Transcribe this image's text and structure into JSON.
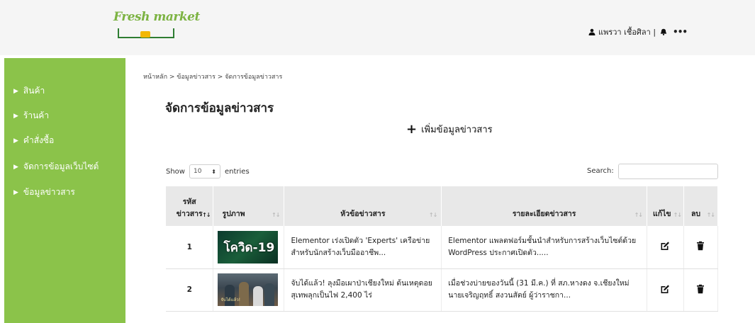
{
  "header": {
    "logo_text": "Fresh market",
    "user_name": "แพรวา เชื้อศิลา |",
    "more_label": "•••"
  },
  "sidebar": {
    "items": [
      {
        "label": "สินค้า"
      },
      {
        "label": "ร้านค้า"
      },
      {
        "label": "คำสั่งซื้อ"
      },
      {
        "label": "จัดการข้อมูลเว็บไซต์"
      },
      {
        "label": "ข้อมูลข่าวสาร"
      }
    ]
  },
  "breadcrumb": "หน้าหลัก > ข้อมูลข่าวสาร > จัดการข้อมูลข่าวสาร",
  "page_title": "จัดการข้อมูลข่าวสาร",
  "add_button": {
    "plus": "+",
    "label": "เพิ่มข้อมูลข่าวสาร"
  },
  "table_controls": {
    "show_label": "Show",
    "page_size": "10",
    "entries_label": "entries",
    "search_label": "Search:",
    "search_value": ""
  },
  "table": {
    "columns": [
      {
        "line1": "รหัส",
        "line2": "ข่าวสาร",
        "sort": "↑↓"
      },
      {
        "line1": "",
        "line2": "รูปภาพ",
        "sort": "↑↓"
      },
      {
        "line1": "",
        "line2": "หัวข้อข่าวสาร",
        "sort": "↑↓"
      },
      {
        "line1": "",
        "line2": "รายละเอียดข่าวสาร",
        "sort": "↑↓"
      },
      {
        "line1": "",
        "line2": "แก้ไข",
        "sort": "↑↓"
      },
      {
        "line1": "",
        "line2": "ลบ",
        "sort": "↑↓"
      }
    ],
    "rows": [
      {
        "id": "1",
        "image_text": "โควิด-19",
        "title": "Elementor เร่งเปิดตัว 'Experts' เครือข่ายสำหรับนักสร้างเว็บมืออาชีพ...",
        "detail": "Elementor แพลตฟอร์มชั้นนำสำหรับการสร้างเว็บไซต์ด้วย WordPress ประกาศเปิดตัว....."
      },
      {
        "id": "2",
        "image_text": "จับได้แล้ว!",
        "title": "จับได้แล้ว! ลุงมือเผาป่าเชียงใหม่ ต้นเหตุดอยสุเทพลุกเป็นไฟ 2,400 ไร่",
        "detail": "เมื่อช่วงบ่ายของวันนี้ (31 มี.ค.) ที่ สภ.หางดง จ.เชียงใหม่ นายเจริญฤทธิ์ สงวนสัตย์ ผู้ว่าราชกา..."
      }
    ]
  },
  "colors": {
    "sidebar": "#8bc34a",
    "topbar": "#f5f5f5",
    "table_header": "#e8e8e8"
  }
}
